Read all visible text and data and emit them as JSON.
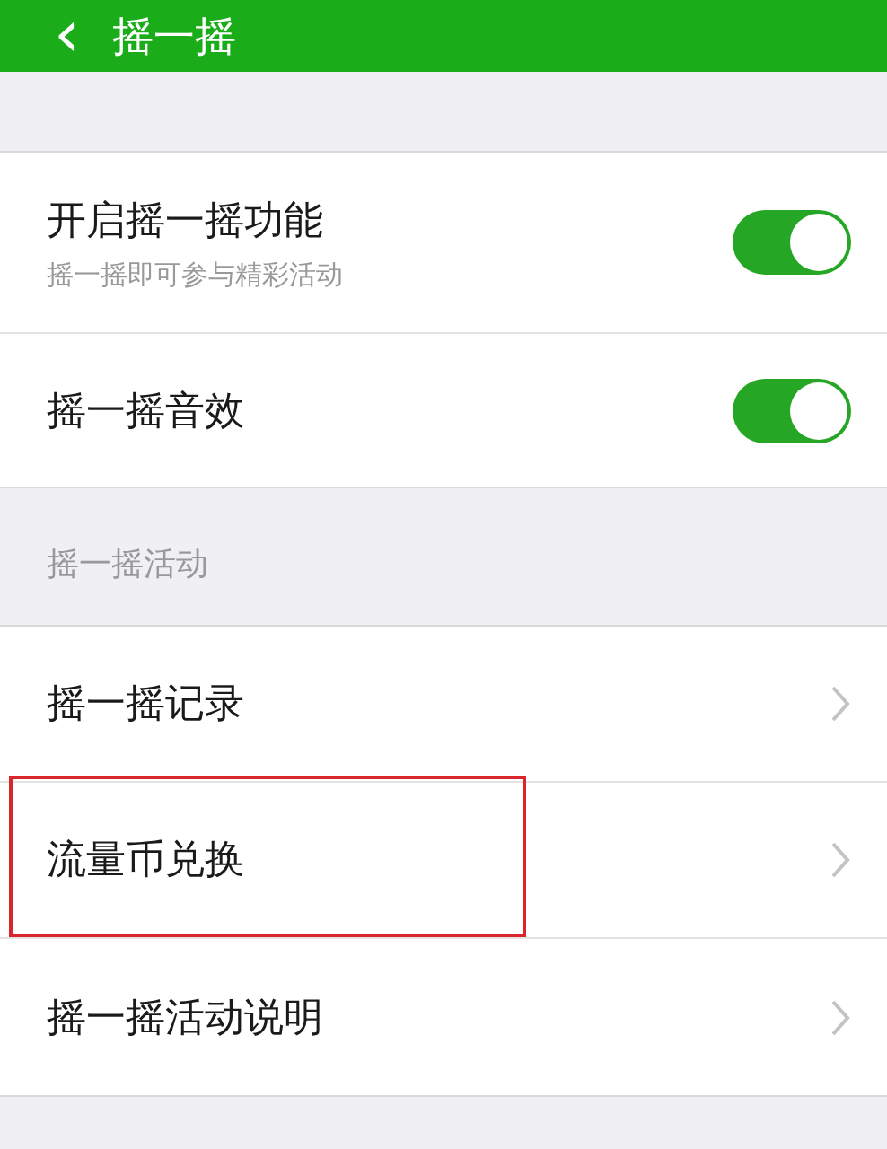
{
  "header": {
    "back_icon": "‹",
    "title": "摇一摇"
  },
  "settings": [
    {
      "label": "开启摇一摇功能",
      "subtitle": "摇一摇即可参与精彩活动",
      "on": true
    },
    {
      "label": "摇一摇音效",
      "on": true
    }
  ],
  "section_title": "摇一摇活动",
  "links": [
    {
      "label": "摇一摇记录",
      "highlighted": false
    },
    {
      "label": "流量币兑换",
      "highlighted": true
    },
    {
      "label": "摇一摇活动说明",
      "highlighted": false
    }
  ]
}
